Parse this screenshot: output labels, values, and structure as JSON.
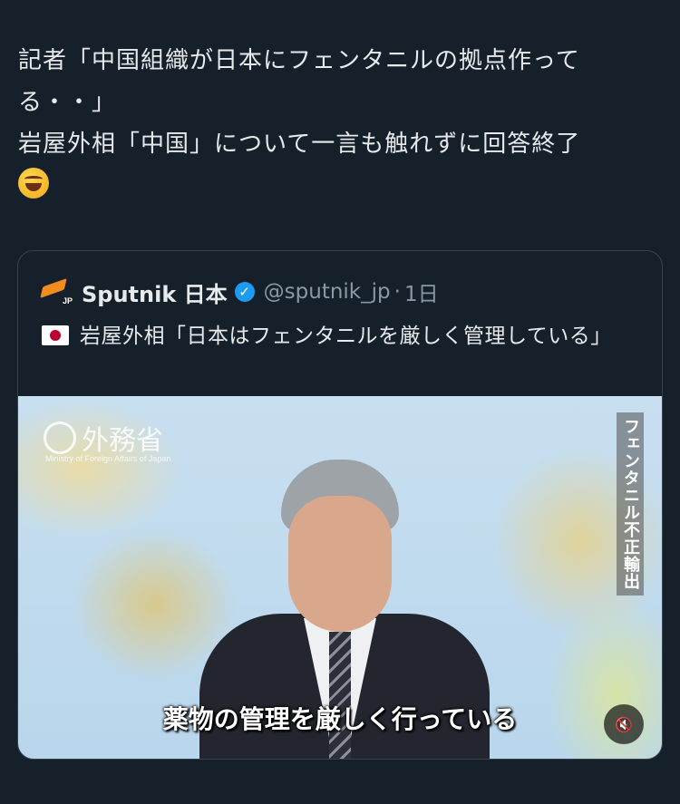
{
  "post": {
    "text_lines": [
      "記者「中国組織が日本にフェンタニルの拠点作って",
      "る・・」",
      "岩屋外相「中国」について一言も触れずに回答終了"
    ],
    "emoji": "rolling-on-floor-laughing-icon"
  },
  "quote": {
    "author_name": "Sputnik 日本",
    "handle": "@sputnik_jp",
    "separator": "·",
    "time": "1日",
    "logo_label": "JP",
    "verified_mark": "✓",
    "text": "岩屋外相「日本はフェンタニルを厳しく管理している」",
    "media": {
      "ministry_logo_text": "外務省",
      "ministry_sub_text": "Ministry of Foreign Affairs of Japan",
      "vertical_caption": "フェンタニル不正輸出",
      "subtitle": "薬物の管理を厳しく行っている",
      "mute_glyph": "🔇"
    }
  },
  "colors": {
    "background": "#15202b",
    "text": "#e7e9ea",
    "muted": "#8b98a5",
    "verified": "#1d9bf0",
    "border": "#38444d"
  }
}
